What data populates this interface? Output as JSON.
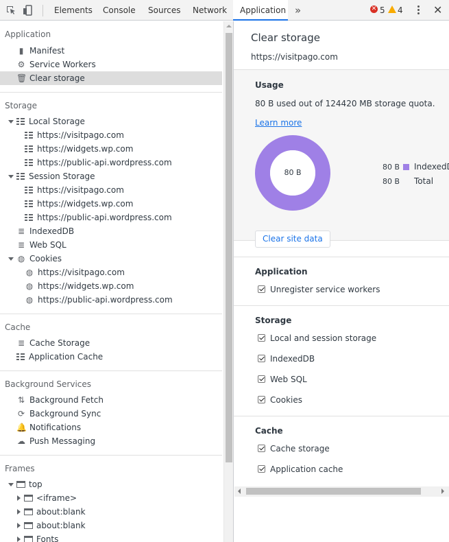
{
  "toolbar": {
    "tabs": [
      {
        "label": "Elements"
      },
      {
        "label": "Console"
      },
      {
        "label": "Sources"
      },
      {
        "label": "Network"
      },
      {
        "label": "Application"
      }
    ],
    "more_tabs": "»",
    "errors_count": "5",
    "warnings_count": "4",
    "close": "✕",
    "icons": [
      "inspect-icon",
      "device-toggle-icon",
      "error-icon",
      "warning-icon",
      "kebab-menu-icon",
      "close-icon"
    ]
  },
  "sidebar": {
    "application": {
      "title": "Application",
      "items": [
        {
          "label": "Manifest",
          "icon": "document-icon"
        },
        {
          "label": "Service Workers",
          "icon": "gear-icon"
        },
        {
          "label": "Clear storage",
          "icon": "trash-icon",
          "selected": true
        }
      ]
    },
    "storage": {
      "title": "Storage",
      "local_storage": {
        "label": "Local Storage",
        "origins": [
          "https://visitpago.com",
          "https://widgets.wp.com",
          "https://public-api.wordpress.com"
        ]
      },
      "session_storage": {
        "label": "Session Storage",
        "origins": [
          "https://visitpago.com",
          "https://widgets.wp.com",
          "https://public-api.wordpress.com"
        ]
      },
      "indexeddb": "IndexedDB",
      "websql": "Web SQL",
      "cookies": {
        "label": "Cookies",
        "origins": [
          "https://visitpago.com",
          "https://widgets.wp.com",
          "https://public-api.wordpress.com"
        ]
      }
    },
    "cache": {
      "title": "Cache",
      "items": [
        {
          "label": "Cache Storage",
          "icon": "database-icon"
        },
        {
          "label": "Application Cache",
          "icon": "grid-icon"
        }
      ]
    },
    "background_services": {
      "title": "Background Services",
      "items": [
        {
          "label": "Background Fetch",
          "icon": "fetch-arrows-icon"
        },
        {
          "label": "Background Sync",
          "icon": "sync-icon"
        },
        {
          "label": "Notifications",
          "icon": "bell-icon"
        },
        {
          "label": "Push Messaging",
          "icon": "cloud-icon"
        }
      ]
    },
    "frames": {
      "title": "Frames",
      "top": "top",
      "children": [
        "<iframe>",
        "about:blank",
        "about:blank"
      ],
      "fonts": "Fonts"
    }
  },
  "main": {
    "title": "Clear storage",
    "origin": "https://visitpago.com",
    "usage": {
      "heading": "Usage",
      "text": "80 B used out of 124420 MB storage quota.",
      "learn_more": "Learn more",
      "donut_label": "80 B",
      "legend": [
        {
          "value": "80 B",
          "name": "IndexedDB",
          "color": "#9f80e6"
        },
        {
          "value": "80 B",
          "name": "Total"
        }
      ],
      "indexeddb_fraction": 1
    },
    "clear_button": "Clear site data",
    "application": {
      "heading": "Application",
      "options": [
        {
          "label": "Unregister service workers",
          "checked": true
        }
      ]
    },
    "storage": {
      "heading": "Storage",
      "options": [
        {
          "label": "Local and session storage",
          "checked": true
        },
        {
          "label": "IndexedDB",
          "checked": true
        },
        {
          "label": "Web SQL",
          "checked": true
        },
        {
          "label": "Cookies",
          "checked": true
        }
      ]
    },
    "cache": {
      "heading": "Cache",
      "options": [
        {
          "label": "Cache storage",
          "checked": true
        },
        {
          "label": "Application cache",
          "checked": true
        }
      ]
    }
  },
  "colors": {
    "accent": "#1a73e8",
    "donut": "#9f80e6",
    "selected_row": "#dddddd",
    "error": "#d93025",
    "warning": "#f9ab00"
  }
}
